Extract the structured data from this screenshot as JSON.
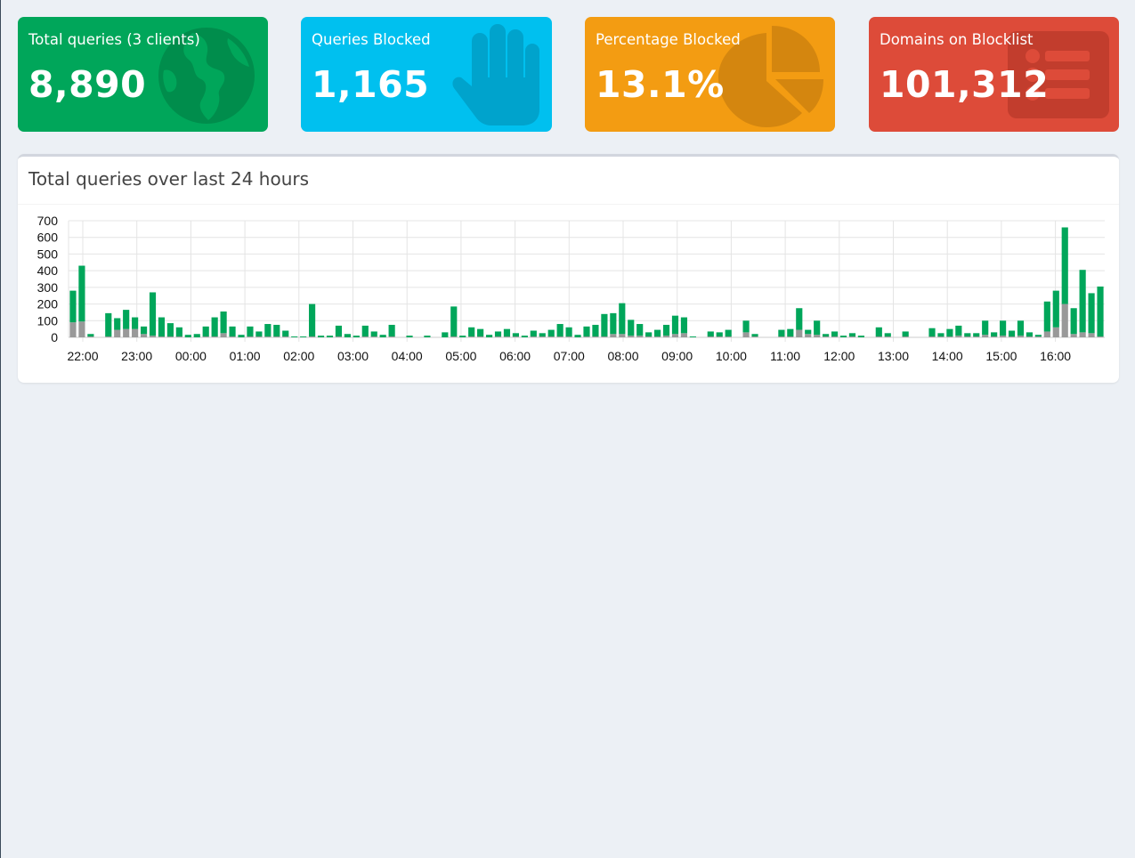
{
  "tiles": [
    {
      "label": "Total queries (3 clients)",
      "value": "8,890",
      "color": "#00a65a",
      "icon": "globe-icon"
    },
    {
      "label": "Queries Blocked",
      "value": "1,165",
      "color": "#00c0ef",
      "icon": "hand-icon"
    },
    {
      "label": "Percentage Blocked",
      "value": "13.1%",
      "color": "#f39c12",
      "icon": "pie-chart-icon"
    },
    {
      "label": "Domains on Blocklist",
      "value": "101,312",
      "color": "#dd4b39",
      "icon": "list-icon"
    }
  ],
  "panel": {
    "title": "Total queries over last 24 hours"
  },
  "chart_data": {
    "type": "bar",
    "stacked": true,
    "ylim": [
      0,
      700
    ],
    "yticks": [
      "0",
      "100",
      "200",
      "300",
      "400",
      "500",
      "600",
      "700"
    ],
    "xticks": [
      "22:00",
      "23:00",
      "00:00",
      "01:00",
      "02:00",
      "03:00",
      "04:00",
      "05:00",
      "06:00",
      "07:00",
      "08:00",
      "09:00",
      "10:00",
      "11:00",
      "12:00",
      "13:00",
      "14:00",
      "15:00",
      "16:00"
    ],
    "grid": true,
    "colors": {
      "permitted": "#00a65a",
      "blocked": "#999999"
    },
    "series": [
      {
        "values": [
          190,
          335,
          15,
          0,
          140,
          70,
          115,
          70,
          45,
          260,
          115,
          80,
          55,
          15,
          20,
          60,
          115,
          130,
          60,
          15,
          60,
          30,
          75,
          70,
          35,
          5,
          5,
          195,
          10,
          10,
          65,
          20,
          10,
          65,
          30,
          15,
          70,
          0,
          10,
          0,
          10,
          0,
          30,
          180,
          10,
          55,
          45,
          15,
          30,
          45,
          20,
          10,
          35,
          20,
          40,
          75,
          55,
          15,
          60,
          70,
          135,
          125,
          185,
          95,
          70,
          25,
          40,
          65,
          110,
          95,
          5,
          0,
          30,
          25,
          40,
          0,
          70,
          15,
          0,
          0,
          40,
          45,
          130,
          25,
          85,
          15,
          30,
          10,
          20,
          10,
          0,
          55,
          20,
          0,
          30,
          0,
          0,
          50,
          20,
          45,
          60,
          20,
          20,
          85,
          25,
          90,
          35,
          90,
          25,
          10,
          180,
          220,
          460,
          155,
          375,
          240,
          300
        ]
      },
      {
        "values": [
          90,
          95,
          5,
          0,
          5,
          45,
          50,
          50,
          20,
          10,
          5,
          5,
          5,
          0,
          0,
          5,
          5,
          25,
          5,
          0,
          5,
          5,
          5,
          5,
          5,
          0,
          0,
          5,
          0,
          0,
          5,
          0,
          0,
          5,
          5,
          0,
          5,
          0,
          0,
          0,
          0,
          0,
          0,
          5,
          0,
          5,
          5,
          0,
          5,
          5,
          5,
          0,
          5,
          5,
          5,
          5,
          5,
          0,
          5,
          5,
          5,
          20,
          20,
          10,
          10,
          5,
          5,
          10,
          20,
          25,
          0,
          0,
          5,
          5,
          5,
          0,
          30,
          5,
          0,
          0,
          5,
          5,
          45,
          20,
          15,
          5,
          5,
          0,
          5,
          0,
          0,
          5,
          5,
          0,
          5,
          0,
          0,
          5,
          5,
          5,
          10,
          5,
          5,
          15,
          5,
          10,
          5,
          10,
          5,
          5,
          35,
          60,
          200,
          20,
          30,
          25,
          5
        ]
      }
    ]
  }
}
